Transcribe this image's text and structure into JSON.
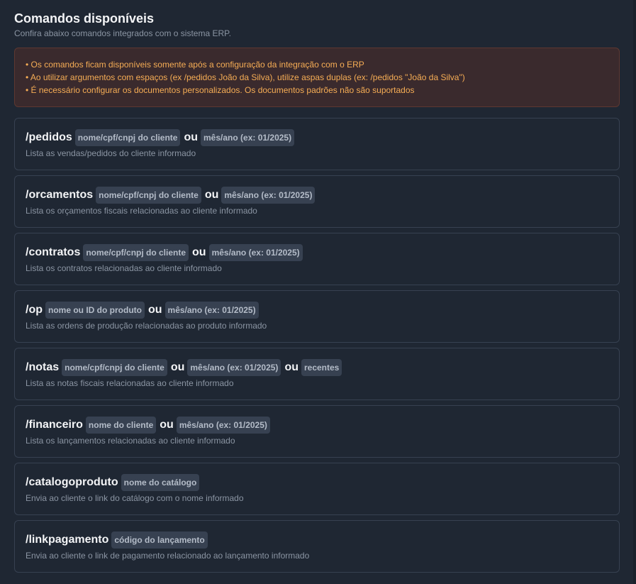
{
  "header": {
    "title": "Comandos disponíveis",
    "subtitle": "Confira abaixo comandos integrados com o sistema ERP."
  },
  "warning": {
    "lines": [
      "• Os comandos ficam disponíveis somente após a configuração da integração com o ERP",
      "• Ao utilizar argumentos com espaços (ex /pedidos João da Silva), utilize aspas duplas (ex: /pedidos \"João da Silva\")",
      "• É necessário configurar os documentos personalizados. Os documentos padrões não são suportados"
    ]
  },
  "separator": "ou",
  "colors": {
    "background": "#1f2733",
    "card_border": "#374151",
    "badge_bg": "#374151",
    "warning_bg": "#3a2a2d",
    "warning_border": "#5e3830",
    "warning_text": "#f6ad55"
  },
  "commands": [
    {
      "name": "/pedidos",
      "args": [
        "nome/cpf/cnpj do cliente",
        "mês/ano (ex: 01/2025)"
      ],
      "description": "Lista as vendas/pedidos do cliente informado"
    },
    {
      "name": "/orcamentos",
      "args": [
        "nome/cpf/cnpj do cliente",
        "mês/ano (ex: 01/2025)"
      ],
      "description": "Lista os orçamentos fiscais relacionadas ao cliente informado"
    },
    {
      "name": "/contratos",
      "args": [
        "nome/cpf/cnpj do cliente",
        "mês/ano (ex: 01/2025)"
      ],
      "description": "Lista os contratos relacionadas ao cliente informado"
    },
    {
      "name": "/op",
      "args": [
        "nome ou ID do produto",
        "mês/ano (ex: 01/2025)"
      ],
      "description": "Lista as ordens de produção relacionadas ao produto informado"
    },
    {
      "name": "/notas",
      "args": [
        "nome/cpf/cnpj do cliente",
        "mês/ano (ex: 01/2025)",
        "recentes"
      ],
      "description": "Lista as notas fiscais relacionadas ao cliente informado"
    },
    {
      "name": "/financeiro",
      "args": [
        "nome do cliente",
        "mês/ano (ex: 01/2025)"
      ],
      "description": "Lista os lançamentos relacionadas ao cliente informado"
    },
    {
      "name": "/catalogoproduto",
      "args": [
        "nome do catálogo"
      ],
      "description": "Envia ao cliente o link do catálogo com o nome informado"
    },
    {
      "name": "/linkpagamento",
      "args": [
        "código do lançamento"
      ],
      "description": "Envia ao cliente o link de pagamento relacionado ao lançamento informado"
    }
  ]
}
